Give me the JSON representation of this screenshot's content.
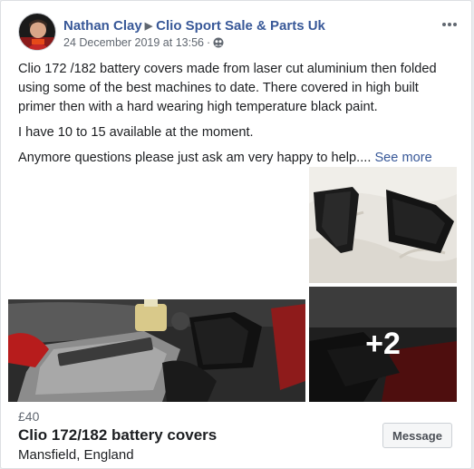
{
  "post": {
    "author": "Nathan Clay",
    "group": "Clio Sport Sale & Parts Uk",
    "date": "24 December 2019 at 13:56",
    "dot": "·",
    "paragraphs": [
      "Clio 172 /182 battery covers made from laser cut aluminium then folded using some of the best machines to date. There covered in high built primer then with a hard wearing high temperature black paint.",
      "I have 10 to 15 available at the moment.",
      "Anymore questions please just ask am very happy to help...."
    ],
    "see_more": "See more"
  },
  "gallery": {
    "more_count": "+2"
  },
  "listing": {
    "price": "£40",
    "title": "Clio 172/182 battery covers",
    "location": "Mansfield, England",
    "message_label": "Message"
  },
  "icons": {
    "more": "more-horizontal-icon",
    "privacy": "group-privacy-icon",
    "breadcrumb": "triangle-right-icon"
  },
  "colors": {
    "link": "#385898",
    "secondary_text": "#606770",
    "background": "#e9ebee"
  }
}
